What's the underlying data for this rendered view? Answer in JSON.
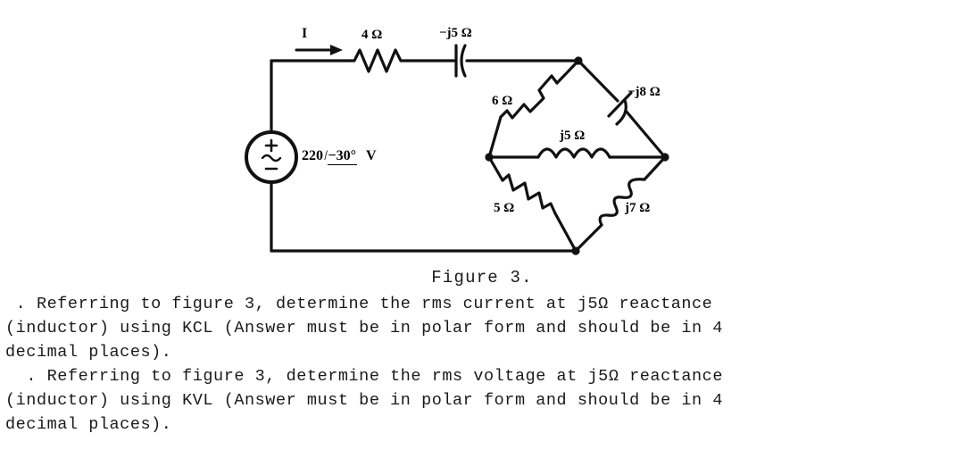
{
  "figure": {
    "caption": "Figure 3.",
    "source": {
      "magnitude": "220",
      "angle": "−30°",
      "unit": "V",
      "plus_sign": "+",
      "minus_sign": "−",
      "wave_sign": "~"
    },
    "current_label": "I",
    "components": [
      {
        "id": "r4",
        "label": "4 Ω",
        "type": "resistor"
      },
      {
        "id": "c5",
        "label": "−j5 Ω",
        "type": "capacitor"
      },
      {
        "id": "r6",
        "label": "6 Ω",
        "type": "resistor"
      },
      {
        "id": "c8",
        "label": "−j8 Ω",
        "type": "capacitor"
      },
      {
        "id": "l5",
        "label": "j5 Ω",
        "type": "inductor"
      },
      {
        "id": "r5",
        "label": "5 Ω",
        "type": "resistor"
      },
      {
        "id": "l7",
        "label": "j7 Ω",
        "type": "inductor"
      }
    ]
  },
  "questions": [
    {
      "id": "q1",
      "text": " . Referring to figure 3, determine the rms current at j5Ω reactance\n(inductor) using KCL (Answer must be in polar form and should be in 4\ndecimal places)."
    },
    {
      "id": "q2",
      "text": "  . Referring to figure 3, determine the rms voltage at j5Ω reactance\n(inductor) using KVL (Answer must be in polar form and should be in 4\ndecimal places)."
    }
  ],
  "colors": {
    "ink": "#111111",
    "paper": "#ffffff"
  }
}
